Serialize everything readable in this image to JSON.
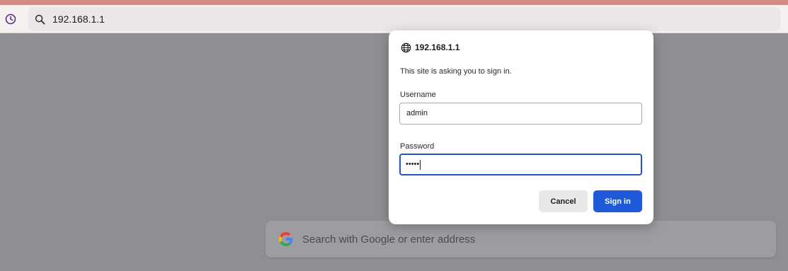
{
  "browser": {
    "url": "192.168.1.1",
    "history_icon": "clock-icon",
    "search_icon": "search-icon"
  },
  "new_tab": {
    "search_placeholder": "Search with Google or enter address",
    "search_engine_icon": "google-icon"
  },
  "auth_dialog": {
    "host": "192.168.1.1",
    "host_icon": "globe-icon",
    "message": "This site is asking you to sign in.",
    "username_label": "Username",
    "username_value": "admin",
    "password_label": "Password",
    "password_value": "•••••",
    "cancel_label": "Cancel",
    "signin_label": "Sign in"
  },
  "colors": {
    "accent": "#1f5bd8",
    "focus_border": "#1e56c4",
    "backdrop": "#8f8f93",
    "top_strip": "#d48b86"
  }
}
